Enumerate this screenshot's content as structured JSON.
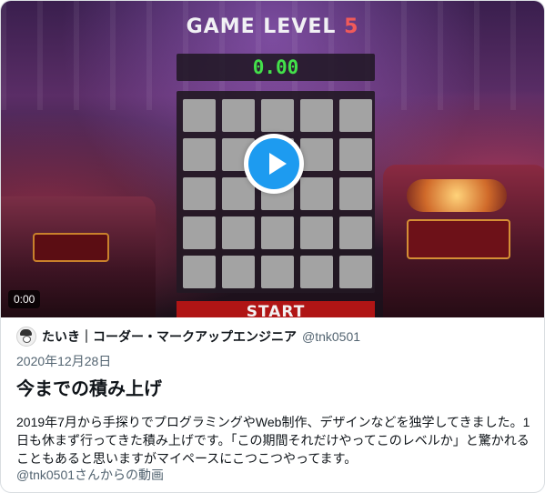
{
  "video": {
    "game_title_prefix": "GAME LEVEL ",
    "game_level": "5",
    "timer": "0.00",
    "tiles": 25,
    "start_label": "START",
    "elapsed": "0:00"
  },
  "author": {
    "name": "たいき｜コーダー・マークアップエンジニア",
    "handle": "@tnk0501"
  },
  "post": {
    "date": "2020年12月28日",
    "title": "今までの積み上げ",
    "description": "2019年7月から手探りでプログラミングやWeb制作、デザインなどを独学してきました。1日も休まず行ってきた積み上げです。「この期間それだけやってこのレベルか」と驚かれることもあると思いますがマイペースにこつこつやってます。",
    "credit": "@tnk0501さんからの動画"
  }
}
